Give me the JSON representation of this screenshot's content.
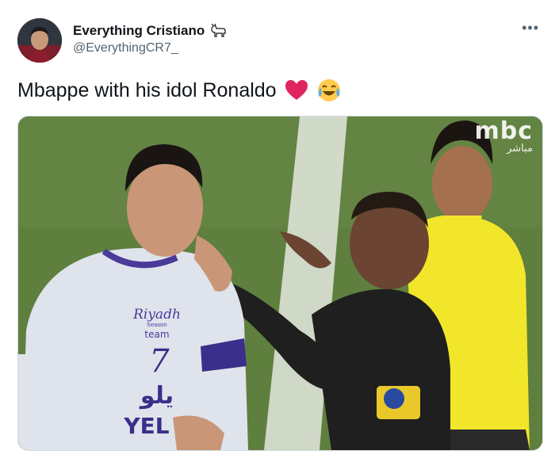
{
  "tweet": {
    "author_name": "Everything Cristiano",
    "author_handle": "@EverythingCR7_",
    "text": "Mbappe with his idol Ronaldo",
    "more_icon": "more-options-icon",
    "name_badge_icon": "goat-icon",
    "emojis": [
      "red-heart-icon",
      "crying-laughing-icon"
    ]
  },
  "media": {
    "watermark_logo": "mbc",
    "watermark_live": "مباشر",
    "shirt_sponsor_top": "Riyadh",
    "shirt_sponsor_sub": "Season",
    "shirt_team": "team",
    "shirt_number": "7",
    "shirt_yelo_arabic": "يلو",
    "shirt_yelo": "YEL"
  },
  "colors": {
    "pitch": "#5d7d3e",
    "accent_text": "#0f1419",
    "secondary_text": "#536471",
    "heart": "#e0245e"
  }
}
